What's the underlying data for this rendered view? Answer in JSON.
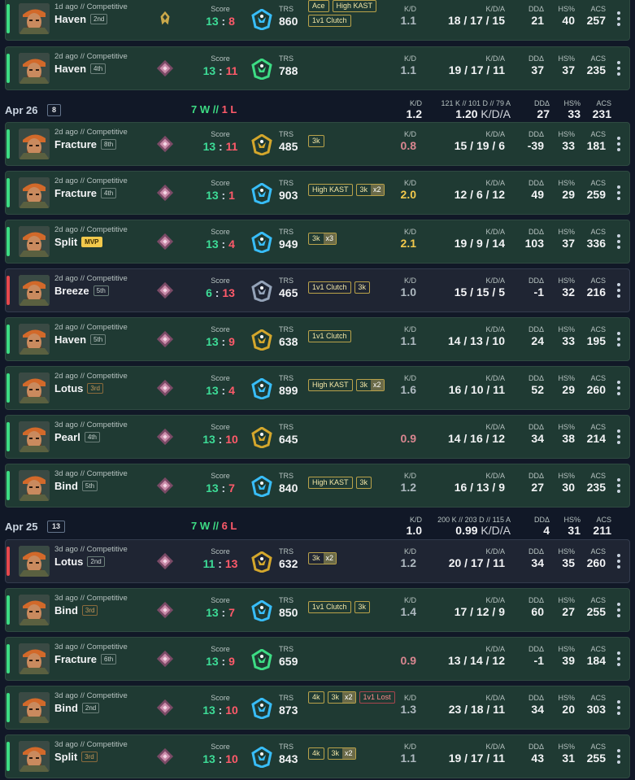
{
  "labels": {
    "score": "Score",
    "trs": "TRS",
    "kd": "K/D",
    "kda": "K/D/A",
    "dd": "DDΔ",
    "hs": "HS%",
    "acs": "ACS"
  },
  "rows": [
    {
      "kind": "match",
      "result": "win",
      "ago": "1d ago // Competitive",
      "map": "Haven",
      "place": "2nd",
      "place_style": "normal",
      "rank_icon": "radiant-rank-icon",
      "score_us": "13",
      "score_them": "8",
      "us_color": "g",
      "them_color": "r",
      "trs_icon": "trs-blue-icon",
      "trs": "860",
      "badges": [
        {
          "label": "Ace"
        },
        {
          "label": "High KAST"
        },
        {
          "label": "1v1 Clutch"
        }
      ],
      "kd": "1.1",
      "kd_style": "normal",
      "kda": "18 / 17 / 15",
      "dd": "21",
      "hs": "40",
      "acs": "257"
    },
    {
      "kind": "match",
      "result": "win",
      "ago": "2d ago // Competitive",
      "map": "Haven",
      "place": "4th",
      "place_style": "normal",
      "rank_icon": "diamond-rank-icon",
      "score_us": "13",
      "score_them": "11",
      "us_color": "g",
      "them_color": "r",
      "trs_icon": "trs-green-icon",
      "trs": "788",
      "badges": [],
      "kd": "1.1",
      "kd_style": "normal",
      "kda": "19 / 17 / 11",
      "dd": "37",
      "hs": "37",
      "acs": "235"
    },
    {
      "kind": "day",
      "date": "Apr 26",
      "count": "8",
      "wins": "7 W",
      "losses": "1 L",
      "kd": "1.2",
      "kda_sub": "121 K // 101 D // 79 A",
      "kda": "1.20",
      "kda_suffix": "K/D/A",
      "dd": "27",
      "hs": "33",
      "acs": "231"
    },
    {
      "kind": "match",
      "result": "win",
      "ago": "2d ago // Competitive",
      "map": "Fracture",
      "place": "8th",
      "place_style": "normal",
      "rank_icon": "diamond-rank-icon",
      "score_us": "13",
      "score_them": "11",
      "us_color": "g",
      "them_color": "r",
      "trs_icon": "trs-gold-icon",
      "trs": "485",
      "badges": [
        {
          "label": "3k"
        }
      ],
      "kd": "0.8",
      "kd_style": "bad",
      "kda": "15 / 19 / 6",
      "dd": "-39",
      "hs": "33",
      "acs": "181"
    },
    {
      "kind": "match",
      "result": "win",
      "ago": "2d ago // Competitive",
      "map": "Fracture",
      "place": "4th",
      "place_style": "normal",
      "rank_icon": "diamond-rank-icon",
      "score_us": "13",
      "score_them": "1",
      "us_color": "g",
      "them_color": "r",
      "trs_icon": "trs-blue-icon",
      "trs": "903",
      "badges": [
        {
          "label": "High KAST"
        },
        {
          "label": "3k",
          "mult": "x2"
        }
      ],
      "kd": "2.0",
      "kd_style": "gold",
      "kda": "12 / 6 / 12",
      "dd": "49",
      "hs": "29",
      "acs": "259"
    },
    {
      "kind": "match",
      "result": "win",
      "ago": "2d ago // Competitive",
      "map": "Split",
      "place": "MVP",
      "place_style": "mvp",
      "rank_icon": "diamond-rank-icon",
      "score_us": "13",
      "score_them": "4",
      "us_color": "g",
      "them_color": "r",
      "trs_icon": "trs-blue-icon",
      "trs": "949",
      "badges": [
        {
          "label": "3k",
          "mult": "x3"
        }
      ],
      "kd": "2.1",
      "kd_style": "gold",
      "kda": "19 / 9 / 14",
      "dd": "103",
      "hs": "37",
      "acs": "336"
    },
    {
      "kind": "match",
      "result": "loss",
      "ago": "2d ago // Competitive",
      "map": "Breeze",
      "place": "5th",
      "place_style": "normal",
      "rank_icon": "diamond-rank-icon",
      "score_us": "6",
      "score_them": "13",
      "us_color": "g",
      "them_color": "r",
      "trs_icon": "trs-gray-icon",
      "trs": "465",
      "badges": [
        {
          "label": "1v1 Clutch"
        },
        {
          "label": "3k"
        }
      ],
      "kd": "1.0",
      "kd_style": "normal",
      "kda": "15 / 15 / 5",
      "dd": "-1",
      "hs": "32",
      "acs": "216"
    },
    {
      "kind": "match",
      "result": "win",
      "ago": "2d ago // Competitive",
      "map": "Haven",
      "place": "5th",
      "place_style": "normal",
      "rank_icon": "diamond-rank-icon",
      "score_us": "13",
      "score_them": "9",
      "us_color": "g",
      "them_color": "r",
      "trs_icon": "trs-gold-icon",
      "trs": "638",
      "badges": [
        {
          "label": "1v1 Clutch"
        }
      ],
      "kd": "1.1",
      "kd_style": "normal",
      "kda": "14 / 13 / 10",
      "dd": "24",
      "hs": "33",
      "acs": "195"
    },
    {
      "kind": "match",
      "result": "win",
      "ago": "2d ago // Competitive",
      "map": "Lotus",
      "place": "3rd",
      "place_style": "low",
      "rank_icon": "diamond-rank-icon",
      "score_us": "13",
      "score_them": "4",
      "us_color": "g",
      "them_color": "r",
      "trs_icon": "trs-blue-icon",
      "trs": "899",
      "badges": [
        {
          "label": "High KAST"
        },
        {
          "label": "3k",
          "mult": "x2"
        }
      ],
      "kd": "1.6",
      "kd_style": "normal",
      "kda": "16 / 10 / 11",
      "dd": "52",
      "hs": "29",
      "acs": "260"
    },
    {
      "kind": "match",
      "result": "win",
      "ago": "3d ago // Competitive",
      "map": "Pearl",
      "place": "4th",
      "place_style": "normal",
      "rank_icon": "diamond-rank-icon",
      "score_us": "13",
      "score_them": "10",
      "us_color": "g",
      "them_color": "r",
      "trs_icon": "trs-gold-icon",
      "trs": "645",
      "badges": [],
      "kd": "0.9",
      "kd_style": "bad",
      "kda": "14 / 16 / 12",
      "dd": "34",
      "hs": "38",
      "acs": "214"
    },
    {
      "kind": "match",
      "result": "win",
      "ago": "3d ago // Competitive",
      "map": "Bind",
      "place": "5th",
      "place_style": "normal",
      "rank_icon": "diamond-rank-icon",
      "score_us": "13",
      "score_them": "7",
      "us_color": "g",
      "them_color": "r",
      "trs_icon": "trs-blue-icon",
      "trs": "840",
      "badges": [
        {
          "label": "High KAST"
        },
        {
          "label": "3k"
        }
      ],
      "kd": "1.2",
      "kd_style": "normal",
      "kda": "16 / 13 / 9",
      "dd": "27",
      "hs": "30",
      "acs": "235"
    },
    {
      "kind": "day",
      "date": "Apr 25",
      "count": "13",
      "wins": "7 W",
      "losses": "6 L",
      "kd": "1.0",
      "kda_sub": "200 K // 203 D // 115 A",
      "kda": "0.99",
      "kda_suffix": "K/D/A",
      "dd": "4",
      "hs": "31",
      "acs": "211"
    },
    {
      "kind": "match",
      "result": "loss",
      "ago": "3d ago // Competitive",
      "map": "Lotus",
      "place": "2nd",
      "place_style": "normal",
      "rank_icon": "diamond-rank-icon",
      "score_us": "11",
      "score_them": "13",
      "us_color": "g",
      "them_color": "r",
      "trs_icon": "trs-gold-icon",
      "trs": "632",
      "badges": [
        {
          "label": "3k",
          "mult": "x2"
        }
      ],
      "kd": "1.2",
      "kd_style": "normal",
      "kda": "20 / 17 / 11",
      "dd": "34",
      "hs": "35",
      "acs": "260"
    },
    {
      "kind": "match",
      "result": "win",
      "ago": "3d ago // Competitive",
      "map": "Bind",
      "place": "3rd",
      "place_style": "low",
      "rank_icon": "diamond-rank-icon",
      "score_us": "13",
      "score_them": "7",
      "us_color": "g",
      "them_color": "r",
      "trs_icon": "trs-blue-icon",
      "trs": "850",
      "badges": [
        {
          "label": "1v1 Clutch"
        },
        {
          "label": "3k"
        }
      ],
      "kd": "1.4",
      "kd_style": "normal",
      "kda": "17 / 12 / 9",
      "dd": "60",
      "hs": "27",
      "acs": "255"
    },
    {
      "kind": "match",
      "result": "win",
      "ago": "3d ago // Competitive",
      "map": "Fracture",
      "place": "6th",
      "place_style": "normal",
      "rank_icon": "diamond-rank-icon",
      "score_us": "13",
      "score_them": "9",
      "us_color": "g",
      "them_color": "r",
      "trs_icon": "trs-green-icon",
      "trs": "659",
      "badges": [],
      "kd": "0.9",
      "kd_style": "bad",
      "kda": "13 / 14 / 12",
      "dd": "-1",
      "hs": "39",
      "acs": "184"
    },
    {
      "kind": "match",
      "result": "win",
      "ago": "3d ago // Competitive",
      "map": "Bind",
      "place": "2nd",
      "place_style": "normal",
      "rank_icon": "diamond-rank-icon",
      "score_us": "13",
      "score_them": "10",
      "us_color": "g",
      "them_color": "r",
      "trs_icon": "trs-blue-icon",
      "trs": "873",
      "badges": [
        {
          "label": "4k"
        },
        {
          "label": "3k",
          "mult": "x2"
        },
        {
          "label": "1v1 Lost",
          "style": "lost"
        }
      ],
      "kd": "1.3",
      "kd_style": "normal",
      "kda": "23 / 18 / 11",
      "dd": "34",
      "hs": "20",
      "acs": "303"
    },
    {
      "kind": "match",
      "result": "win",
      "ago": "3d ago // Competitive",
      "map": "Split",
      "place": "3rd",
      "place_style": "low",
      "rank_icon": "diamond-rank-icon",
      "score_us": "13",
      "score_them": "10",
      "us_color": "g",
      "them_color": "r",
      "trs_icon": "trs-blue-icon",
      "trs": "843",
      "badges": [
        {
          "label": "4k"
        },
        {
          "label": "3k",
          "mult": "x2"
        }
      ],
      "kd": "1.1",
      "kd_style": "normal",
      "kda": "19 / 17 / 11",
      "dd": "43",
      "hs": "31",
      "acs": "255"
    }
  ],
  "colors": {
    "win_bar": "#3ddc84",
    "loss_bar": "#e5484d",
    "score_win": "#3ddc97",
    "score_loss": "#ff5a6a",
    "trs_blue": "#38bdf8",
    "trs_green": "#3ddc84",
    "trs_gold": "#d4a72c",
    "trs_gray": "#94a3b8"
  }
}
